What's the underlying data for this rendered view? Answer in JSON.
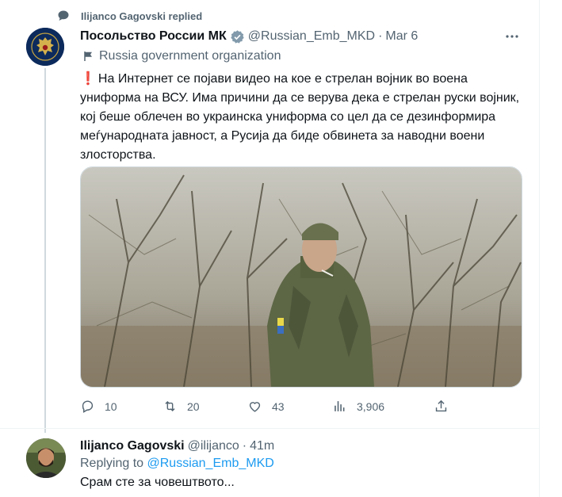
{
  "context": {
    "replied_label": "Ilijanco Gagovski replied"
  },
  "tweet": {
    "display_name": "Посольство России МК",
    "handle": "@Russian_Emb_MKD",
    "separator": "·",
    "date": "Mar 6",
    "org_label": "Russia government organization",
    "text": "На Интернет се појави видео на кое е стрелан војник во воена униформа на ВСУ. Има причини да се верува дека е стрелан руски војник, кој беше облечен во украинска униформа со цел да се дезинформира меѓународната јавност, а Русија да биде обвинета за наводни воени злосторства.",
    "metrics": {
      "replies": "10",
      "retweets": "20",
      "likes": "43",
      "views": "3,906"
    }
  },
  "reply": {
    "display_name": "Ilijanco Gagovski",
    "handle": "@ilijanco",
    "separator": "·",
    "time": "41m",
    "replying_prefix": "Replying to",
    "replying_to": "@Russian_Emb_MKD",
    "text": "Срам сте за човештвото..."
  },
  "icons": {
    "replied": "speech-bubble-icon",
    "verified": "gray-verified-badge-icon",
    "more": "more-dots-icon",
    "org": "flag-icon",
    "exclamation": "red-exclamation-icon",
    "reply": "reply-icon",
    "retweet": "retweet-icon",
    "like": "heart-icon",
    "views": "analytics-bars-icon",
    "share": "share-icon"
  },
  "colors": {
    "link": "#1d9bf0",
    "muted": "#536471",
    "text": "#0f1419",
    "exclamation": "#e0245e"
  }
}
